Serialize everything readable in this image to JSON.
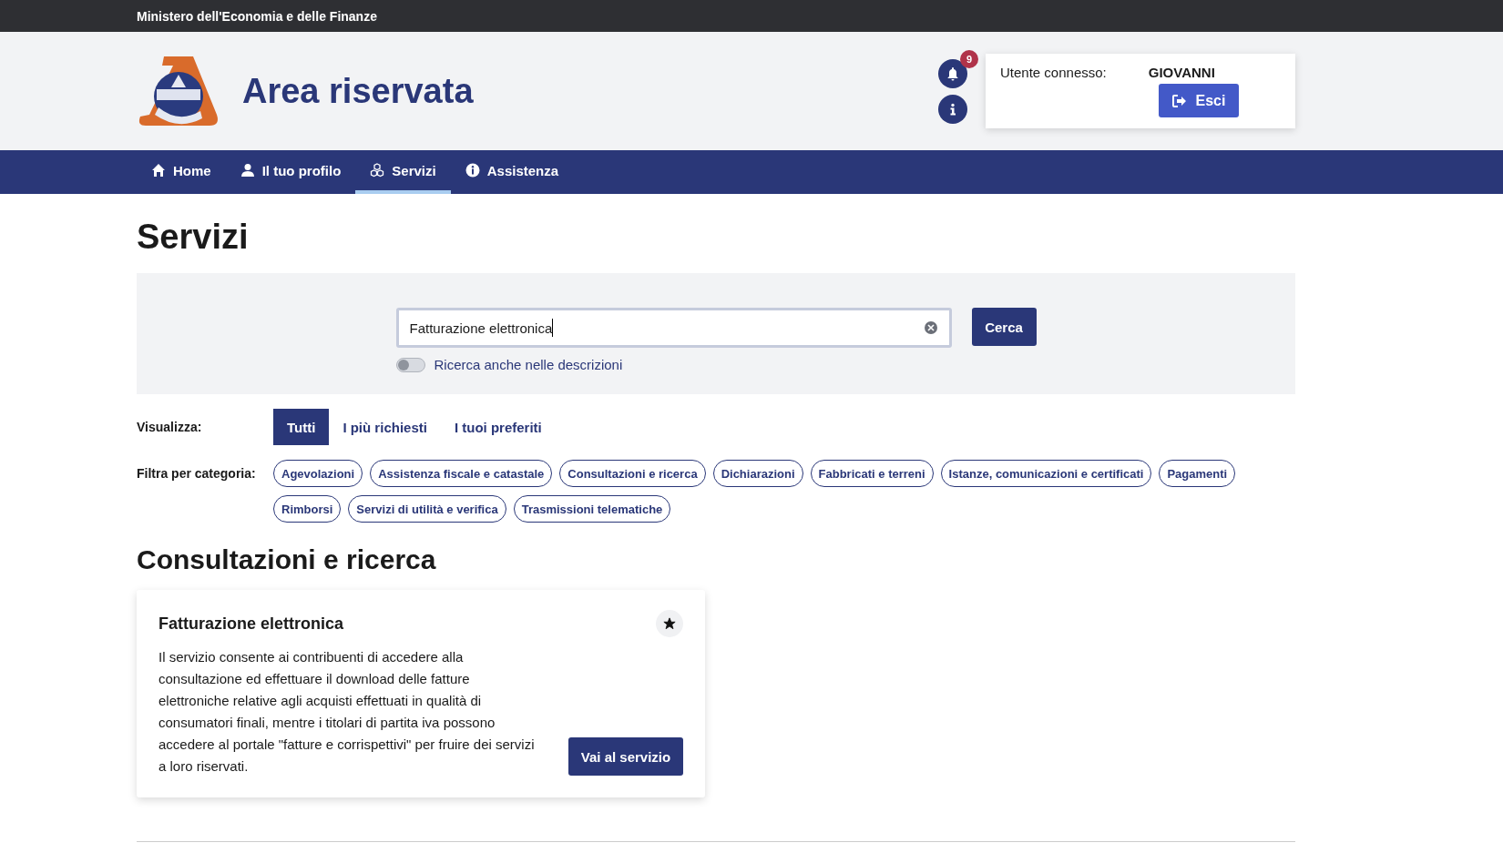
{
  "top_bar": {
    "title": "Ministero dell'Economia e delle Finanze"
  },
  "header": {
    "title": "Area riservata",
    "notifications": {
      "count": "9"
    },
    "user": {
      "label": "Utente connesso:",
      "name": "GIOVANNI",
      "logout": "Esci"
    }
  },
  "nav": [
    {
      "label": "Home",
      "selected": false
    },
    {
      "label": "Il tuo profilo",
      "selected": false
    },
    {
      "label": "Servizi",
      "selected": true
    },
    {
      "label": "Assistenza",
      "selected": false
    }
  ],
  "page_title": "Servizi",
  "search": {
    "value": "Fatturazione elettronica",
    "button": "Cerca",
    "toggle": {
      "label": "Ricerca anche nelle descrizioni",
      "on": false
    }
  },
  "view": {
    "label": "Visualizza:",
    "tabs": [
      {
        "label": "Tutti",
        "selected": true
      },
      {
        "label": "I più richiesti",
        "selected": false
      },
      {
        "label": "I tuoi preferiti",
        "selected": false
      }
    ]
  },
  "filters": {
    "label": "Filtra per categoria:",
    "items": [
      "Agevolazioni",
      "Assistenza fiscale e catastale",
      "Consultazioni e ricerca",
      "Dichiarazioni",
      "Fabbricati e terreni",
      "Istanze, comunicazioni e certificati",
      "Pagamenti",
      "Rimborsi",
      "Servizi di utilità e verifica",
      "Trasmissioni telematiche"
    ]
  },
  "section": {
    "title": "Consultazioni e ricerca",
    "cards": [
      {
        "title": "Fatturazione elettronica",
        "favorite": true,
        "description": "Il servizio consente ai contribuenti di accedere alla consultazione ed effettuare il download delle fatture elettroniche relative agli acquisti effettuati in qualità di consumatori finali, mentre i titolari di partita iva possono accedere al portale \"fatture e corrispettivi\" per fruire dei servizi a loro riservati.",
        "button": "Vai al servizio"
      }
    ]
  }
}
